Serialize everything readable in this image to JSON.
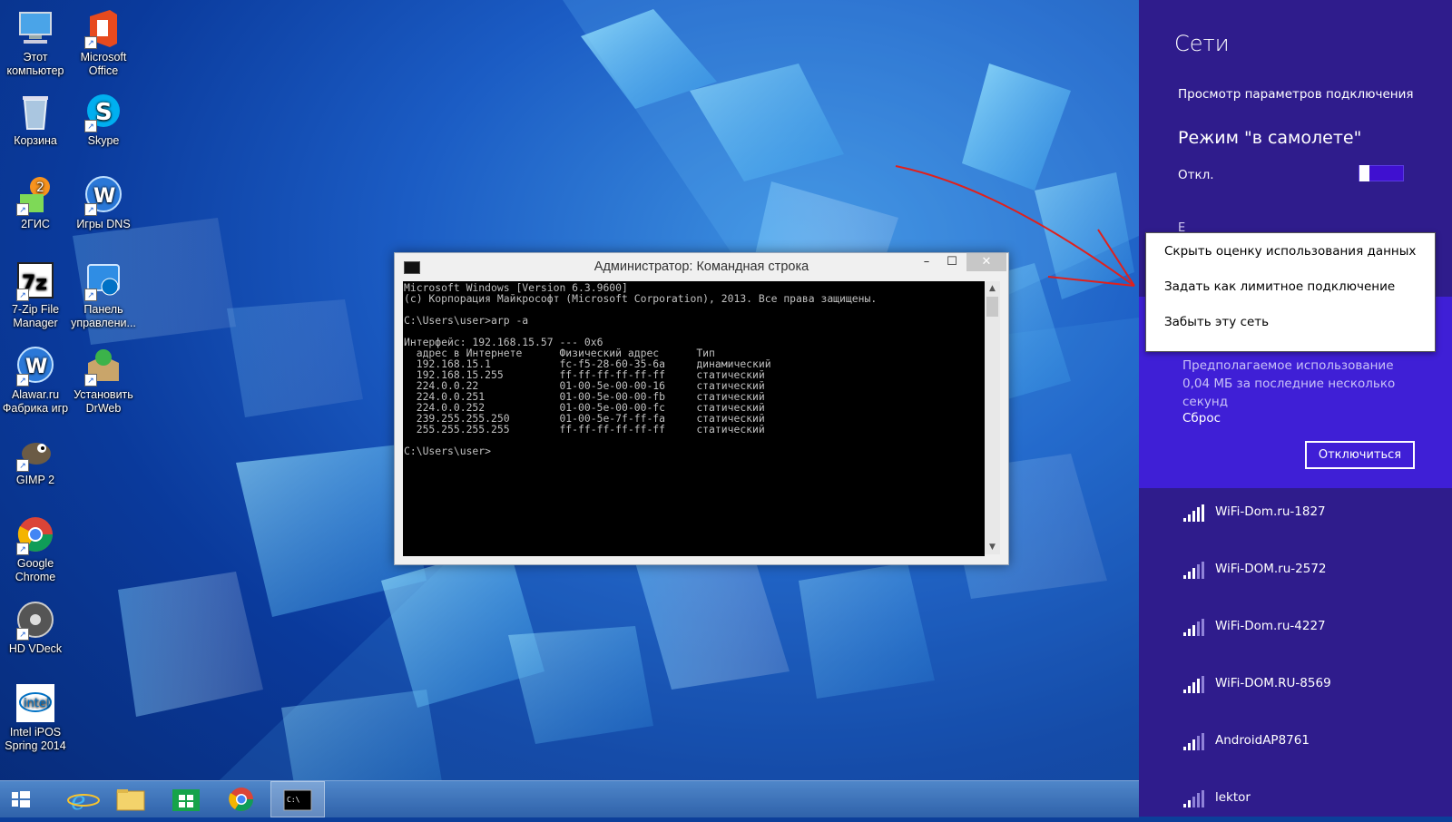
{
  "desktop": {
    "icons": [
      {
        "label": "Этот компьютер",
        "icon": "computer-icon"
      },
      {
        "label": "Microsoft Office",
        "icon": "office-icon"
      },
      {
        "label": "Корзина",
        "icon": "recycle-bin-icon"
      },
      {
        "label": "Skype",
        "icon": "skype-icon"
      },
      {
        "label": "2ГИС",
        "icon": "2gis-icon"
      },
      {
        "label": "Игры DNS",
        "icon": "dns-games-icon"
      },
      {
        "label": "7-Zip File Manager",
        "icon": "7zip-icon"
      },
      {
        "label": "Панель управлени...",
        "icon": "control-panel-icon"
      },
      {
        "label": "Alawar.ru Фабрика игр",
        "icon": "alawar-icon"
      },
      {
        "label": "Установить DrWeb",
        "icon": "drweb-icon"
      },
      {
        "label": "GIMP 2",
        "icon": "gimp-icon"
      },
      {
        "label": "Google Chrome",
        "icon": "chrome-icon"
      },
      {
        "label": "HD VDeck",
        "icon": "hd-vdeck-icon"
      },
      {
        "label": "Intel iPOS Spring 2014",
        "icon": "intel-icon"
      }
    ]
  },
  "cmd": {
    "title": "Администратор: Командная строка",
    "minimize_glyph": "–",
    "maximize_glyph": "☐",
    "close_glyph": "✕",
    "scroll_up_glyph": "▲",
    "scroll_down_glyph": "▼",
    "lines": [
      "Microsoft Windows [Version 6.3.9600]",
      "(c) Корпорация Майкрософт (Microsoft Corporation), 2013. Все права защищены.",
      "",
      "C:\\Users\\user>arp -a",
      "",
      "Интерфейс: 192.168.15.57 --- 0x6",
      "  адрес в Интернете      Физический адрес      Тип",
      "  192.168.15.1           fc-f5-28-60-35-6a     динамический",
      "  192.168.15.255         ff-ff-ff-ff-ff-ff     статический",
      "  224.0.0.22             01-00-5e-00-00-16     статический",
      "  224.0.0.251            01-00-5e-00-00-fb     статический",
      "  224.0.0.252            01-00-5e-00-00-fc     статический",
      "  239.255.255.250        01-00-5e-7f-ff-fa     статический",
      "  255.255.255.255        ff-ff-ff-ff-ff-ff     статический",
      "",
      "C:\\Users\\user>"
    ]
  },
  "taskbar": {
    "items": [
      {
        "icon": "windows-start-icon"
      },
      {
        "icon": "internet-explorer-icon"
      },
      {
        "icon": "file-explorer-icon"
      },
      {
        "icon": "store-icon"
      },
      {
        "icon": "chrome-icon"
      },
      {
        "icon": "cmd-icon",
        "active": true
      }
    ]
  },
  "charm": {
    "title": "Сети",
    "view_settings": "Просмотр параметров подключения",
    "airplane_mode": "Режим \"в самолете\"",
    "airplane_state": "Откл.",
    "airplane_on": false,
    "partial_text": "Е",
    "usage_text": "Предполагаемое использование 0,04 МБ за последние несколько секунд",
    "reset": "Сброс",
    "disconnect": "Отключиться",
    "networks": [
      {
        "name": "WiFi-Dom.ru-1827"
      },
      {
        "name": "WiFi-DOM.ru-2572"
      },
      {
        "name": "WiFi-Dom.ru-4227"
      },
      {
        "name": "WiFi-DOM.RU-8569"
      },
      {
        "name": "AndroidAP8761"
      },
      {
        "name": "lektor"
      }
    ],
    "colors": {
      "panel": "#2f1c8c",
      "connected": "#3f1fd6"
    }
  },
  "context_menu": {
    "items": [
      "Скрыть оценку использования данных",
      "Задать как лимитное подключение",
      "Забыть эту сеть"
    ]
  }
}
